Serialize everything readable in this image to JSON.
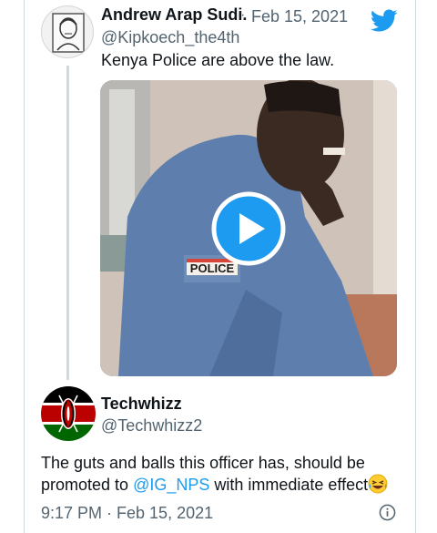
{
  "quoted_tweet": {
    "author_name": "Andrew Arap Sudi.",
    "separator": "·",
    "date": "Feb 15, 2021",
    "handle": "@Kipkoech_the4th",
    "text": "Kenya Police are above the law.",
    "video_badge_text": "POLICE"
  },
  "reply": {
    "author_name": "Techwhizz",
    "handle": "@Techwhizz2",
    "text_before_mention": "The guts and balls this officer has, should be promoted to ",
    "mention": "@IG_NPS",
    "text_after_mention": " with immediate effect",
    "timestamp": "9:17 PM · Feb 15, 2021"
  },
  "colors": {
    "accent": "#1d9bf0",
    "secondary_text": "#536471",
    "primary_text": "#0f1419",
    "uniform_blue": "#5e7fae"
  },
  "icons": [
    "twitter-bird-icon",
    "play-icon",
    "info-icon",
    "laughing-emoji-icon"
  ]
}
